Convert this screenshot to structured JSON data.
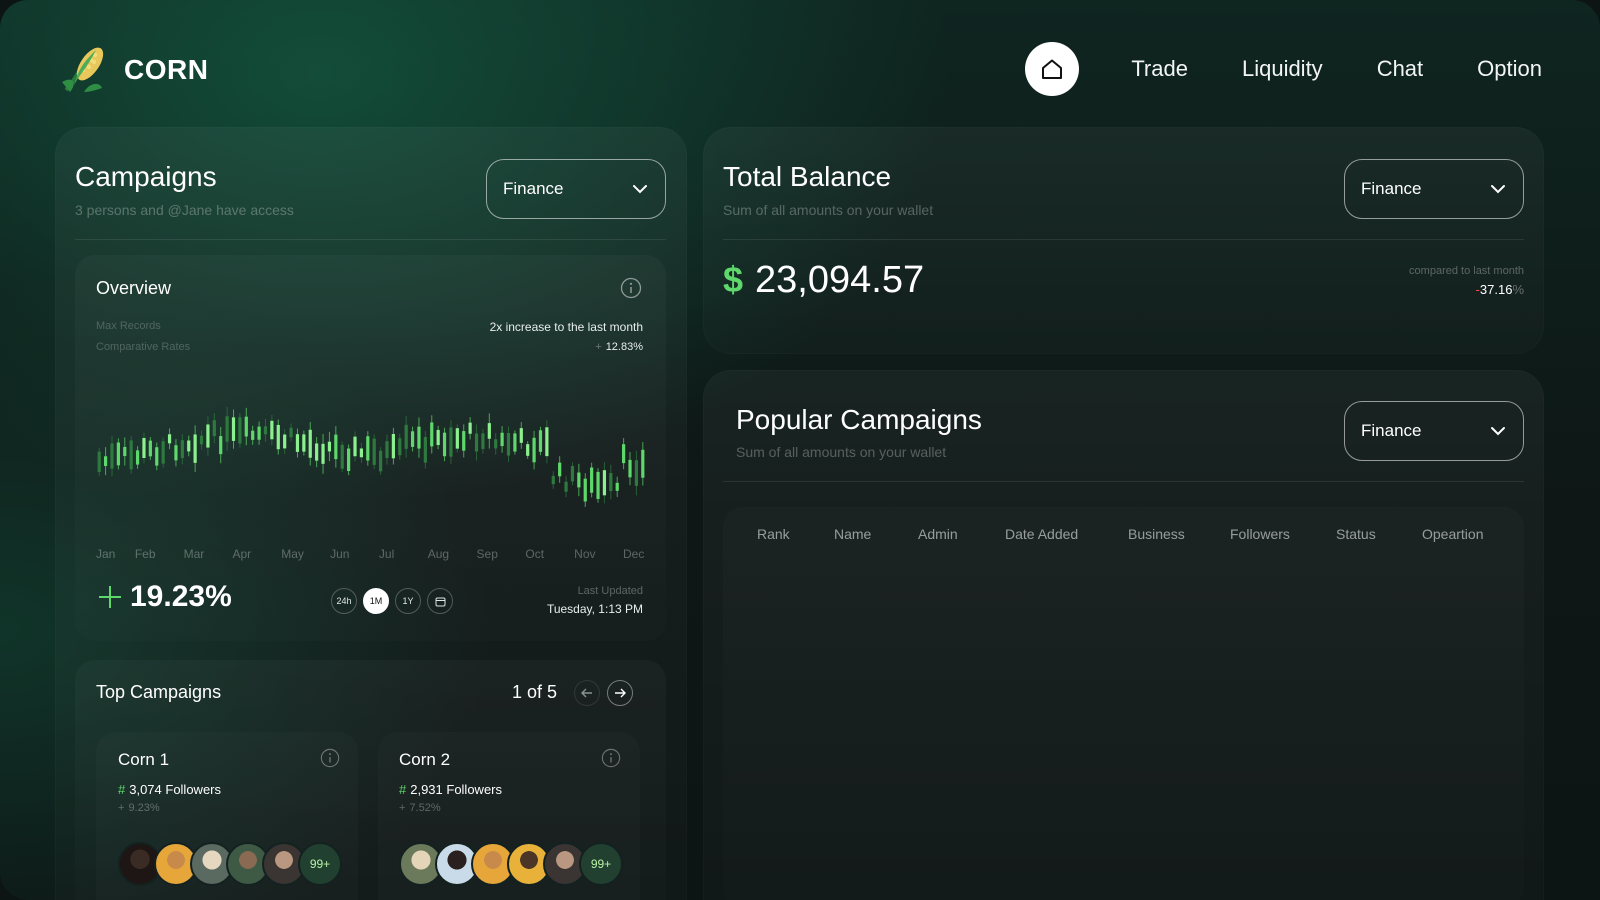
{
  "brand": {
    "name": "CORN"
  },
  "nav": {
    "items": [
      "Trade",
      "Liquidity",
      "Chat",
      "Option"
    ]
  },
  "campaigns": {
    "title": "Campaigns",
    "subtitle": "3 persons and @Jane have access",
    "filter": "Finance"
  },
  "overview": {
    "title": "Overview",
    "legend_max": "Max Records",
    "legend_rates": "Comparative Rates",
    "increase_note": "2x increase to the last month",
    "increase_pct": "12.83%",
    "months": [
      "Jan",
      "Feb",
      "Mar",
      "Apr",
      "May",
      "Jun",
      "Jul",
      "Aug",
      "Sep",
      "Oct",
      "Nov",
      "Dec"
    ],
    "big_change": "19.23%",
    "ranges": [
      "24h",
      "1M",
      "1Y"
    ],
    "active_range": "1M",
    "last_updated_label": "Last Updated",
    "last_updated_value": "Tuesday, 1:13 PM"
  },
  "top_campaigns": {
    "title": "Top Campaigns",
    "pager": "1 of 5",
    "cards": [
      {
        "name": "Corn 1",
        "followers": "3,074 Followers",
        "change": "9.23%",
        "more": "99+"
      },
      {
        "name": "Corn 2",
        "followers": "2,931 Followers",
        "change": "7.52%",
        "more": "99+"
      }
    ]
  },
  "balance": {
    "title": "Total Balance",
    "subtitle": "Sum of all amounts on your wallet",
    "filter": "Finance",
    "currency": "$",
    "amount": "23,094.57",
    "compare_label": "compared to last month",
    "compare_value": "37.16",
    "compare_sign": "-",
    "compare_unit": "%"
  },
  "popular": {
    "title": "Popular Campaigns",
    "subtitle": "Sum of all amounts on your wallet",
    "filter": "Finance",
    "columns": [
      "Rank",
      "Name",
      "Admin",
      "Date Added",
      "Business",
      "Followers",
      "Status",
      "Opeartion"
    ]
  },
  "colors": {
    "accent_green": "#5fd86b",
    "negative_red": "#ff4a4a",
    "background": "#0d1414"
  },
  "icons": [
    "corn-logo-icon",
    "home-icon",
    "chevron-down-icon",
    "info-icon",
    "plus-icon",
    "calendar-icon",
    "arrow-left-icon",
    "arrow-right-icon",
    "hash-icon"
  ]
}
